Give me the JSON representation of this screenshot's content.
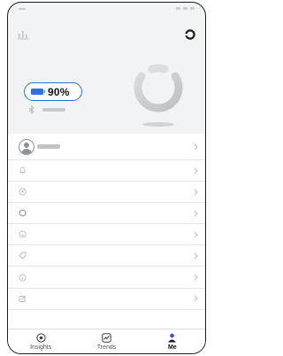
{
  "app": {
    "battery": {
      "label": "90%",
      "level": 0.9
    },
    "colors": {
      "accent": "#2f6fe0",
      "active_nav": "#2b55d8",
      "placeholder": "#c7c9cd"
    }
  },
  "header": {
    "left_icon": "bar-chart-icon",
    "right_icon": "sync-icon"
  },
  "menu": {
    "items": [
      {
        "icon": "bell-icon"
      },
      {
        "icon": "target-icon"
      },
      {
        "icon": "circle-icon"
      },
      {
        "icon": "smile-icon"
      },
      {
        "icon": "tag-icon"
      },
      {
        "icon": "info-icon"
      },
      {
        "icon": "edit-icon"
      }
    ]
  },
  "bottom_nav": {
    "items": [
      {
        "label": "Insights",
        "icon": "insights-icon",
        "active": false
      },
      {
        "label": "Trends",
        "icon": "trends-icon",
        "active": false
      },
      {
        "label": "Me",
        "icon": "person-icon",
        "active": true
      }
    ]
  }
}
